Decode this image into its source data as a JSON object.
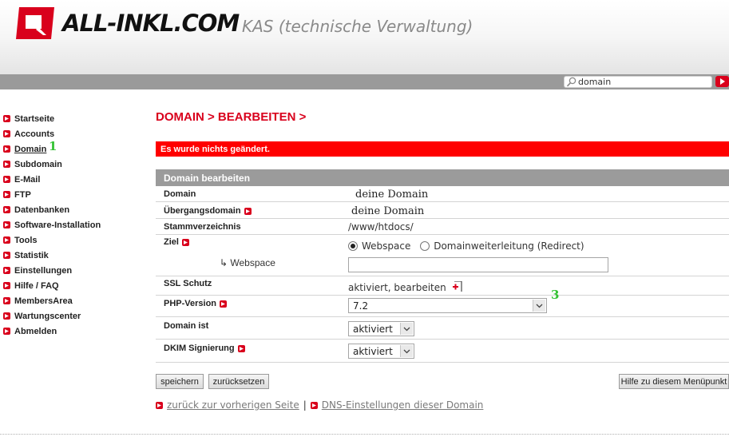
{
  "header": {
    "logo_text": "ALL-INKL.COM",
    "subtitle": "KAS (technische Verwaltung)",
    "search": {
      "value": "domain"
    }
  },
  "sidebar": {
    "items": [
      {
        "label": "Startseite"
      },
      {
        "label": "Accounts"
      },
      {
        "label": "Domain",
        "active": true
      },
      {
        "label": "Subdomain"
      },
      {
        "label": "E-Mail"
      },
      {
        "label": "FTP"
      },
      {
        "label": "Datenbanken"
      },
      {
        "label": "Software-Installation"
      },
      {
        "label": "Tools"
      },
      {
        "label": "Statistik"
      },
      {
        "label": "Einstellungen"
      },
      {
        "label": "Hilfe / FAQ"
      },
      {
        "label": "MembersArea"
      },
      {
        "label": "Wartungscenter"
      },
      {
        "label": "Abmelden"
      }
    ]
  },
  "annotations": {
    "one": "1",
    "three": "3"
  },
  "main": {
    "breadcrumb": "DOMAIN > BEARBEITEN >",
    "alert": "Es wurde nichts geändert.",
    "section_title": "Domain bearbeiten",
    "rows": {
      "domain": {
        "label": "Domain",
        "value": "deine Domain"
      },
      "uebergang": {
        "label": "Übergangsdomain",
        "value": "deine Domain"
      },
      "stamm": {
        "label": "Stammverzeichnis",
        "value": "/www/htdocs/"
      },
      "ziel": {
        "label": "Ziel",
        "option_webspace": "Webspace",
        "option_redirect": "Domainweiterleitung (Redirect)"
      },
      "webspace": {
        "label": "↳ Webspace",
        "value": ""
      },
      "ssl": {
        "label": "SSL Schutz",
        "value": "aktiviert, bearbeiten"
      },
      "php": {
        "label": "PHP-Version",
        "value": "7.2"
      },
      "domain_ist": {
        "label": "Domain ist",
        "value": "aktiviert"
      },
      "dkim": {
        "label": "DKIM Signierung",
        "value": "aktiviert"
      }
    },
    "buttons": {
      "save": "speichern",
      "reset": "zurücksetzen",
      "help": "Hilfe zu diesem Menüpunkt"
    },
    "links": {
      "back": "zurück zur vorherigen Seite",
      "separator": "|",
      "dns": "DNS-Einstellungen dieser Domain"
    }
  },
  "colors": {
    "accent": "#d9001c",
    "alert_bg": "#ff0000",
    "bar_grey": "#9b9b9b",
    "annotation": "#33c233"
  }
}
